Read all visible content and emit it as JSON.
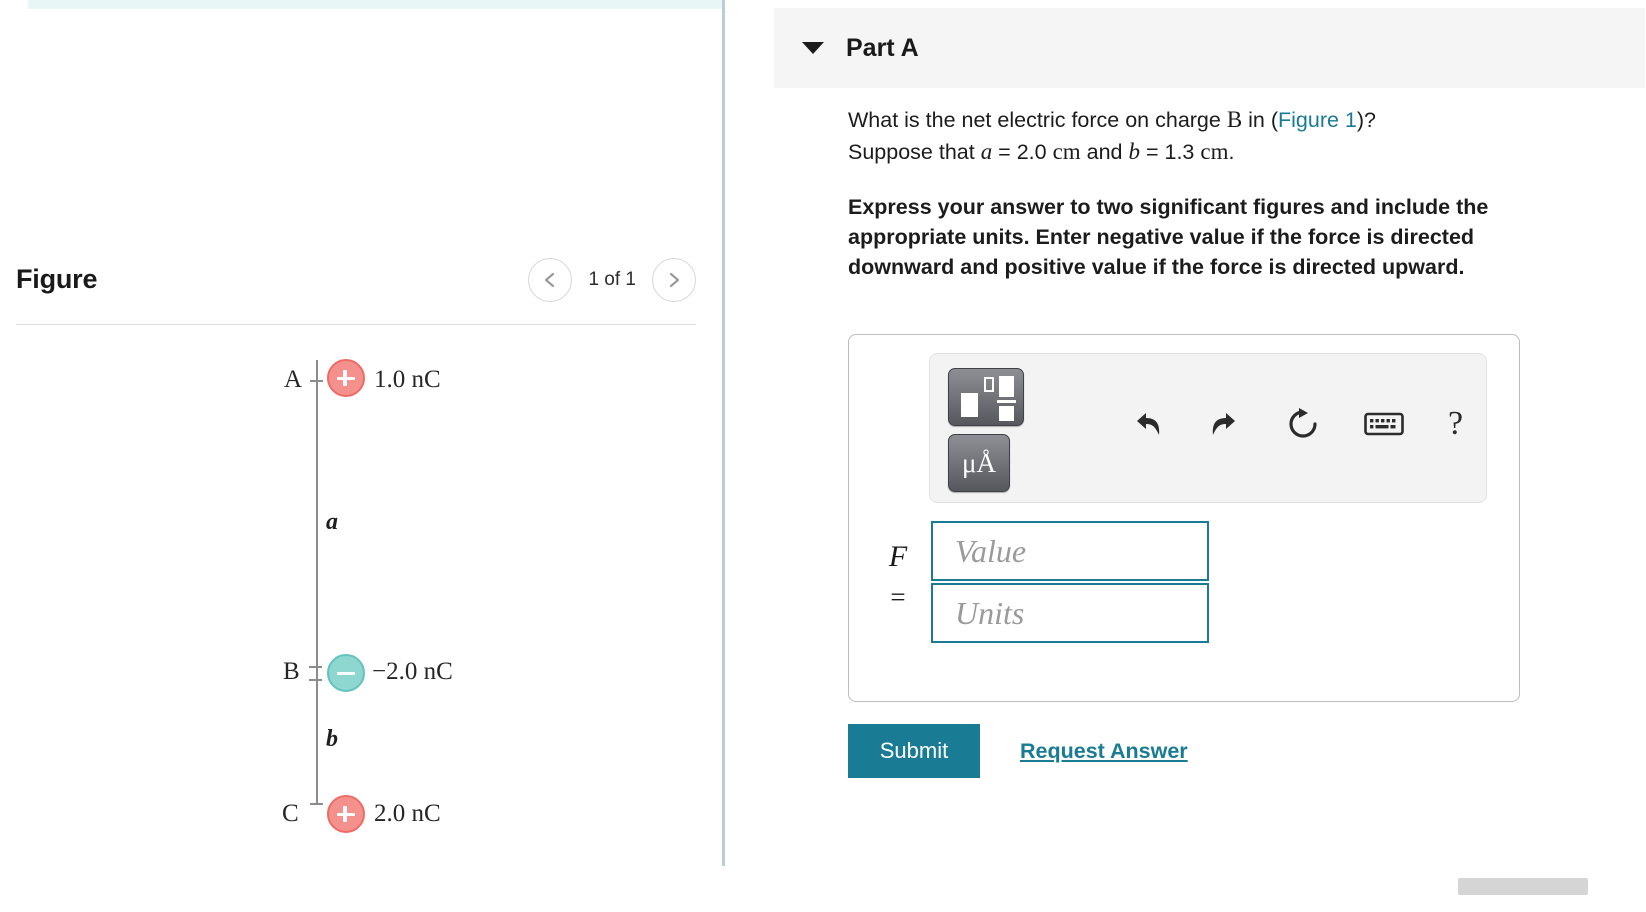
{
  "figure_panel": {
    "title": "Figure",
    "pager": {
      "prev_icon": "chevron-left-icon",
      "label": "1 of 1",
      "next_icon": "chevron-right-icon"
    },
    "diagram": {
      "description": "Vertical line with three point charges A, B and C separated by distances a and b",
      "charges": [
        {
          "point": "A",
          "sign": "+",
          "value": "1.0 nC",
          "polarity": "positive",
          "color": "#f4918c"
        },
        {
          "point": "B",
          "sign": "−",
          "value": "−2.0 nC",
          "polarity": "negative",
          "color": "#8ed6d0"
        },
        {
          "point": "C",
          "sign": "+",
          "value": "2.0 nC",
          "polarity": "positive",
          "color": "#f4918c"
        }
      ],
      "distances": [
        {
          "label": "a",
          "between": "A-B"
        },
        {
          "label": "b",
          "between": "B-C"
        }
      ]
    }
  },
  "question_panel": {
    "part": {
      "title": "Part A",
      "caret_icon": "caret-down-icon"
    },
    "prompt": {
      "line1_a": "What is the net electric force on charge ",
      "line1_var": "B",
      "line1_b": " in (",
      "figure_link": "Figure 1",
      "line1_c": ")?",
      "line2_a": "Suppose that ",
      "var_a": "a",
      "line2_b": " = 2.0 ",
      "unit_a": "cm",
      "line2_c": " and ",
      "var_b": "b",
      "line2_d": " = 1.3 ",
      "unit_b": "cm",
      "line2_e": "."
    },
    "instruction": "Express your answer to two significant figures and include the appropriate units. Enter negative value if the force is directed downward and positive value if the force is directed upward.",
    "answer": {
      "toolbar": {
        "template_button": "template-fraction-button",
        "units_button_label": "μÅ",
        "undo_icon": "undo-icon",
        "redo_icon": "redo-icon",
        "reset_icon": "reset-icon",
        "keyboard_icon": "keyboard-icon",
        "help_icon": "help-question-icon",
        "help_label": "?"
      },
      "variable": "F",
      "equals": "=",
      "value_placeholder": "Value",
      "value": "",
      "units_placeholder": "Units",
      "units": ""
    },
    "actions": {
      "submit_label": "Submit",
      "request_answer_label": "Request Answer"
    }
  },
  "colors": {
    "accent_teal": "#1a7b94",
    "positive_charge": "#f4918c",
    "negative_charge": "#8ed6d0",
    "header_grey": "#f5f5f5",
    "mint_strip": "#e8f6f6",
    "divider_blue": "#b9cddc"
  }
}
